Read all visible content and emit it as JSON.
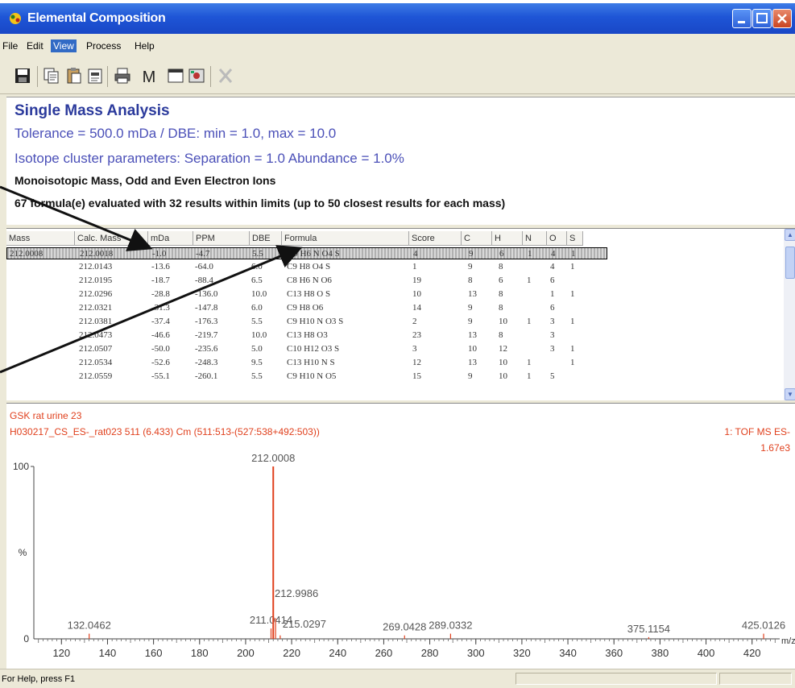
{
  "window": {
    "title": "Elemental Composition"
  },
  "menu": [
    "File",
    "Edit",
    "View",
    "Process",
    "Help"
  ],
  "toolbar_icons": [
    "save-icon",
    "copy-icon",
    "paste-icon",
    "copy-special-icon",
    "print-icon",
    "m-icon",
    "window-icon",
    "settings-icon",
    "delete-icon"
  ],
  "toolbar": {
    "m_label": "M"
  },
  "info": {
    "title": "Single Mass Analysis",
    "line1": "Tolerance = 500.0 mDa  /  DBE: min = 1.0, max = 10.0",
    "line2": "Isotope cluster parameters: Separation = 1.0   Abundance = 1.0%",
    "line3": "Monoisotopic Mass, Odd and Even Electron Ions",
    "line4": "67 formula(e) evaluated with 32 results within limits (up to 50 closest results for each mass)"
  },
  "table": {
    "headers": [
      "Mass",
      "Calc. Mass",
      "mDa",
      "PPM",
      "DBE",
      "Formula",
      "Score",
      "C",
      "H",
      "N",
      "O",
      "S"
    ],
    "selected_row": [
      "212.0008",
      "212.0018",
      "-1.0",
      "-4.7",
      "5.5",
      "C9 H6 N O4 S",
      "4",
      "9",
      "6",
      "1",
      "4",
      "1"
    ],
    "rows": [
      [
        "",
        "212.0143",
        "-13.6",
        "-64.0",
        "6.0",
        "C9 H8 O4 S",
        "1",
        "9",
        "8",
        "",
        "4",
        "1"
      ],
      [
        "",
        "212.0195",
        "-18.7",
        "-88.4",
        "6.5",
        "C8 H6 N O6",
        "19",
        "8",
        "6",
        "1",
        "6",
        ""
      ],
      [
        "",
        "212.0296",
        "-28.8",
        "-136.0",
        "10.0",
        "C13 H8 O S",
        "10",
        "13",
        "8",
        "",
        "1",
        "1"
      ],
      [
        "",
        "212.0321",
        "-31.3",
        "-147.8",
        "6.0",
        "C9 H8 O6",
        "14",
        "9",
        "8",
        "",
        "6",
        ""
      ],
      [
        "",
        "212.0381",
        "-37.4",
        "-176.3",
        "5.5",
        "C9 H10 N O3 S",
        "2",
        "9",
        "10",
        "1",
        "3",
        "1"
      ],
      [
        "",
        "212.0473",
        "-46.6",
        "-219.7",
        "10.0",
        "C13 H8 O3",
        "23",
        "13",
        "8",
        "",
        "3",
        ""
      ],
      [
        "",
        "212.0507",
        "-50.0",
        "-235.6",
        "5.0",
        "C10 H12 O3 S",
        "3",
        "10",
        "12",
        "",
        "3",
        "1"
      ],
      [
        "",
        "212.0534",
        "-52.6",
        "-248.3",
        "9.5",
        "C13 H10 N S",
        "12",
        "13",
        "10",
        "1",
        "",
        "1"
      ],
      [
        "",
        "212.0559",
        "-55.1",
        "-260.1",
        "5.5",
        "C9 H10 N O5",
        "15",
        "9",
        "10",
        "1",
        "5",
        ""
      ]
    ]
  },
  "spectrum": {
    "sample": "GSK rat urine 23",
    "file": "H030217_CS_ES-_rat023 511 (6.433) Cm (511:513-(527:538+492:503))",
    "mode": "1: TOF MS ES-",
    "intensity": "1.67e3"
  },
  "chart_data": {
    "type": "bar",
    "title": "",
    "xlabel": "m/z",
    "ylabel": "%",
    "xlim": [
      108,
      432
    ],
    "ylim": [
      0,
      100
    ],
    "x_ticks": [
      120,
      140,
      160,
      180,
      200,
      220,
      240,
      260,
      280,
      300,
      320,
      340,
      360,
      380,
      400,
      420
    ],
    "y_ticks": [
      "0",
      "100"
    ],
    "peaks": [
      {
        "mz": 132.0462,
        "intensity": 3
      },
      {
        "mz": 211.0414,
        "intensity": 6
      },
      {
        "mz": 212.0008,
        "intensity": 100
      },
      {
        "mz": 212.9986,
        "intensity": 12
      },
      {
        "mz": 215.0297,
        "intensity": 2
      },
      {
        "mz": 269.0428,
        "intensity": 2
      },
      {
        "mz": 289.0332,
        "intensity": 3
      },
      {
        "mz": 375.1154,
        "intensity": 1
      },
      {
        "mz": 425.0126,
        "intensity": 3
      }
    ]
  },
  "status": {
    "text": "For Help, press F1"
  }
}
